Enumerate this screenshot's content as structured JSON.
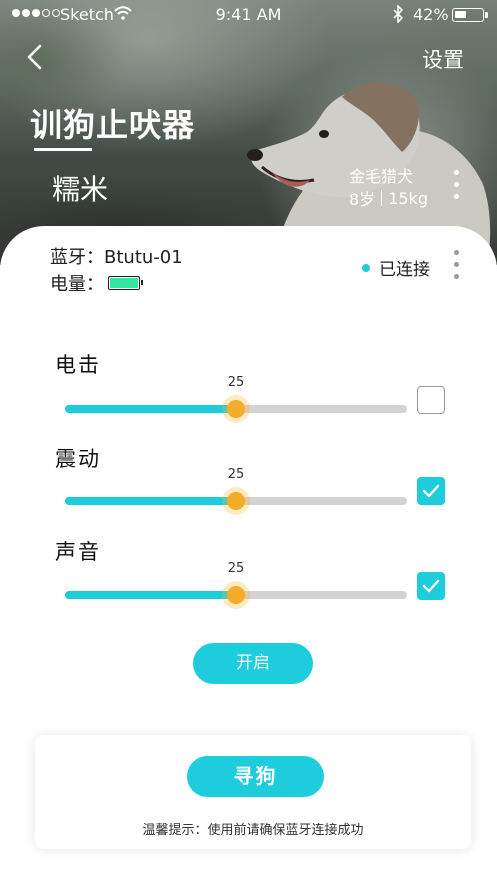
{
  "status_bar": {
    "carrier": "Sketch",
    "time": "9:41 AM",
    "battery_percent": "42%",
    "battery_level": 0.42,
    "signal_bars_filled": 3,
    "signal_bars_total": 5
  },
  "header": {
    "settings_label": "设置",
    "app_title": "训狗止吠器"
  },
  "dog": {
    "name": "糯米",
    "breed": "金毛猎犬",
    "age": "8岁",
    "weight": "15kg"
  },
  "device": {
    "bluetooth_label": "蓝牙：Btutu-01",
    "power_label": "电量：",
    "power_level": 1.0,
    "connection_status": "已连接"
  },
  "controls": [
    {
      "label": "电击",
      "value": "25",
      "level": 0.5,
      "checked": false
    },
    {
      "label": "震动",
      "value": "25",
      "level": 0.5,
      "checked": true
    },
    {
      "label": "声音",
      "value": "25",
      "level": 0.5,
      "checked": true
    }
  ],
  "buttons": {
    "start_label": "开启",
    "find_dog_label": "寻狗"
  },
  "tip": "温馨提示：使用前请确保蓝牙连接成功",
  "colors": {
    "accent": "#1ecddc",
    "thumb": "#f4ad2a",
    "battery_fill": "#33e6a4",
    "track": "#d3d3d3"
  },
  "icons": {
    "back": "chevron-left-icon",
    "more": "more-vertical-icon",
    "check": "checkmark-icon",
    "bluetooth": "bluetooth-icon",
    "wifi": "wifi-icon"
  }
}
